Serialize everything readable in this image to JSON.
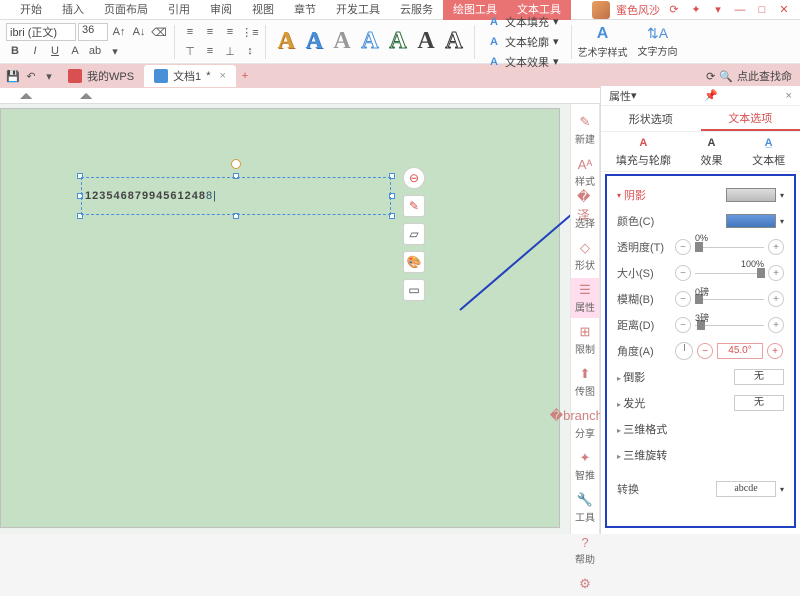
{
  "ribbon": {
    "tabs": [
      "开始",
      "插入",
      "页面布局",
      "引用",
      "审阅",
      "视图",
      "章节",
      "开发工具",
      "云服务"
    ],
    "tool_tabs": [
      "绘图工具",
      "文本工具"
    ],
    "user": "蜜色风沙"
  },
  "font": {
    "name": "ibri (正文)",
    "size": "36"
  },
  "bigA_colors": [
    "#d89b3a",
    "#4a90d9",
    "#888",
    "#4a90d9",
    "#2b6b3a",
    "#333",
    "#333"
  ],
  "text_cmds": {
    "fill": "文本填充",
    "outline": "文本轮廓",
    "effect": "文本效果",
    "style": "艺术字样式",
    "dir": "文字方向"
  },
  "doc_tabs": {
    "wps": "我的WPS",
    "doc1": "文档1"
  },
  "search_hint": "点此查找命",
  "canvas_text": "12354687994561248",
  "side": [
    "新建",
    "样式",
    "选择",
    "形状",
    "属性",
    "限制",
    "传图",
    "分享",
    "智推",
    "工具",
    "帮助"
  ],
  "panel": {
    "title": "属性",
    "tab_shape": "形状选项",
    "tab_text": "文本选项",
    "sub_fill": "填充与轮廓",
    "sub_fx": "效果",
    "sub_box": "文本框",
    "sec_shadow": "阴影",
    "lbl_color": "颜色(C)",
    "lbl_trans": "透明度(T)",
    "lbl_size": "大小(S)",
    "lbl_blur": "模糊(B)",
    "lbl_dist": "距离(D)",
    "lbl_angle": "角度(A)",
    "val_trans": "0%",
    "val_size": "100%",
    "val_blur": "0磅",
    "val_dist": "3磅",
    "val_angle": "45.0°",
    "sec_reflect": "倒影",
    "sec_glow": "发光",
    "sec_3dfmt": "三维格式",
    "sec_3drot": "三维旋转",
    "lbl_transform": "转换",
    "val_none": "无",
    "val_transform": "abcde"
  }
}
